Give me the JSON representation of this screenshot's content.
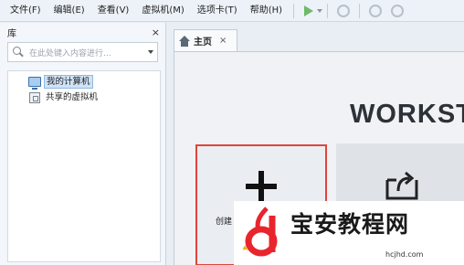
{
  "menubar": {
    "items": [
      "文件(F)",
      "编辑(E)",
      "查看(V)",
      "虚拟机(M)",
      "选项卡(T)",
      "帮助(H)"
    ]
  },
  "library": {
    "title": "库",
    "close": "×",
    "search_placeholder": "在此处键入内容进行...",
    "tree": [
      {
        "label": "我的计算机",
        "icon": "computer-icon",
        "selected": true
      },
      {
        "label": "共享的虚拟机",
        "icon": "shared-vm-icon",
        "selected": false
      }
    ]
  },
  "tab": {
    "label": "主页",
    "close": "×"
  },
  "home": {
    "brand": "WORKST",
    "create_label": "创建",
    "colors": {
      "highlight_border": "#e0453c",
      "accent_green": "#6dbb6a"
    }
  },
  "watermark": {
    "title": "宝安教程网",
    "url": "hcjhd.com"
  }
}
